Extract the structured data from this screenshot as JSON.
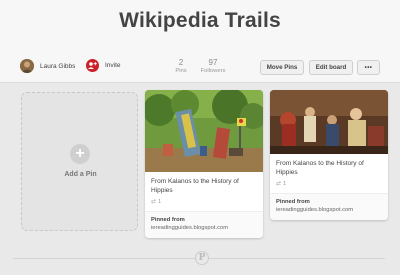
{
  "board": {
    "title": "Wikipedia Trails"
  },
  "owner": {
    "name": "Laura Gibbs"
  },
  "invite": {
    "label": "Invite"
  },
  "stats": [
    {
      "number": "2",
      "label": "Pins"
    },
    {
      "number": "97",
      "label": "Followers"
    }
  ],
  "actions": {
    "move_pins": "Move Pins",
    "edit_board": "Edit board",
    "more": "•••"
  },
  "add_pin": {
    "icon_text": "+",
    "label": "Add a Pin"
  },
  "pins": [
    {
      "title": "From Kalanos to the History of Hippies",
      "repins": "1",
      "from_label": "Pinned from",
      "source": "iereadingguides.blogspot.com"
    },
    {
      "title": "From Kalanos to the History of Hippies",
      "repins": "1",
      "from_label": "Pinned from",
      "source": "iereadingguides.blogspot.com"
    }
  ],
  "footer": {
    "logo_text": "P"
  },
  "colors": {
    "invite": "#cb2027",
    "background": "#e9e9e9"
  },
  "icons": {
    "repin": "repin-icon",
    "add": "plus-icon",
    "invite": "invite-icon",
    "logo": "pinterest-logo-icon"
  }
}
